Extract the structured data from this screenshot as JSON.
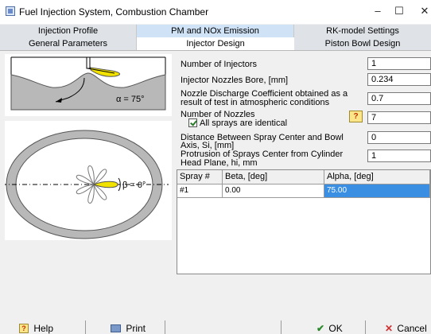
{
  "window": {
    "title": "Fuel Injection System, Combustion Chamber",
    "minimize_glyph": "–",
    "maximize_glyph": "☐",
    "close_glyph": "✕"
  },
  "tabs_row1": [
    "Injection Profile",
    "PM and NOx Emission",
    "RK-model Settings"
  ],
  "tabs_row2": [
    "General Parameters",
    "Injector Design",
    "Piston Bowl Design"
  ],
  "active_tab": "Injector Design",
  "figures": {
    "top_angle_label": "α = 75°",
    "bottom_angle_label": "β = 0°"
  },
  "params": {
    "num_injectors_label": "Number of Injectors",
    "num_injectors_value": "1",
    "bore_label": "Injector Nozzles Bore, [mm]",
    "bore_value": "0.234",
    "discharge_label_line1": "Nozzle Discharge Coefficient obtained as a",
    "discharge_label_line2": "result of test in atmospheric conditions",
    "discharge_value": "0.7",
    "num_nozzles_label": "Number of Nozzles",
    "num_nozzles_value": "7",
    "help_glyph": "?",
    "identical_label": "All sprays are identical",
    "identical_checked": true,
    "distance_label_line1": "Distance Between Spray Center and Bowl",
    "distance_label_line2": "Axis, Si, [mm]",
    "distance_value": "0",
    "protrusion_label_line1": "Protrusion of Sprays Center from Cylinder",
    "protrusion_label_line2": "Head Plane, hi, mm",
    "protrusion_value": "1"
  },
  "spray_table": {
    "headers": [
      "Spray #",
      "Beta, [deg]",
      "Alpha, [deg]"
    ],
    "rows": [
      [
        "#1",
        "0.00",
        "75.00"
      ]
    ]
  },
  "footer": {
    "help_label": "Help",
    "print_label": "Print",
    "ok_label": "OK",
    "cancel_label": "Cancel"
  },
  "colors": {
    "tab_highlight": "#cfe2f6",
    "selected_cell": "#3b8fe3",
    "spray_fill": "#f2e200",
    "ok_check": "#2a8a2a",
    "cancel_x": "#d03030"
  }
}
